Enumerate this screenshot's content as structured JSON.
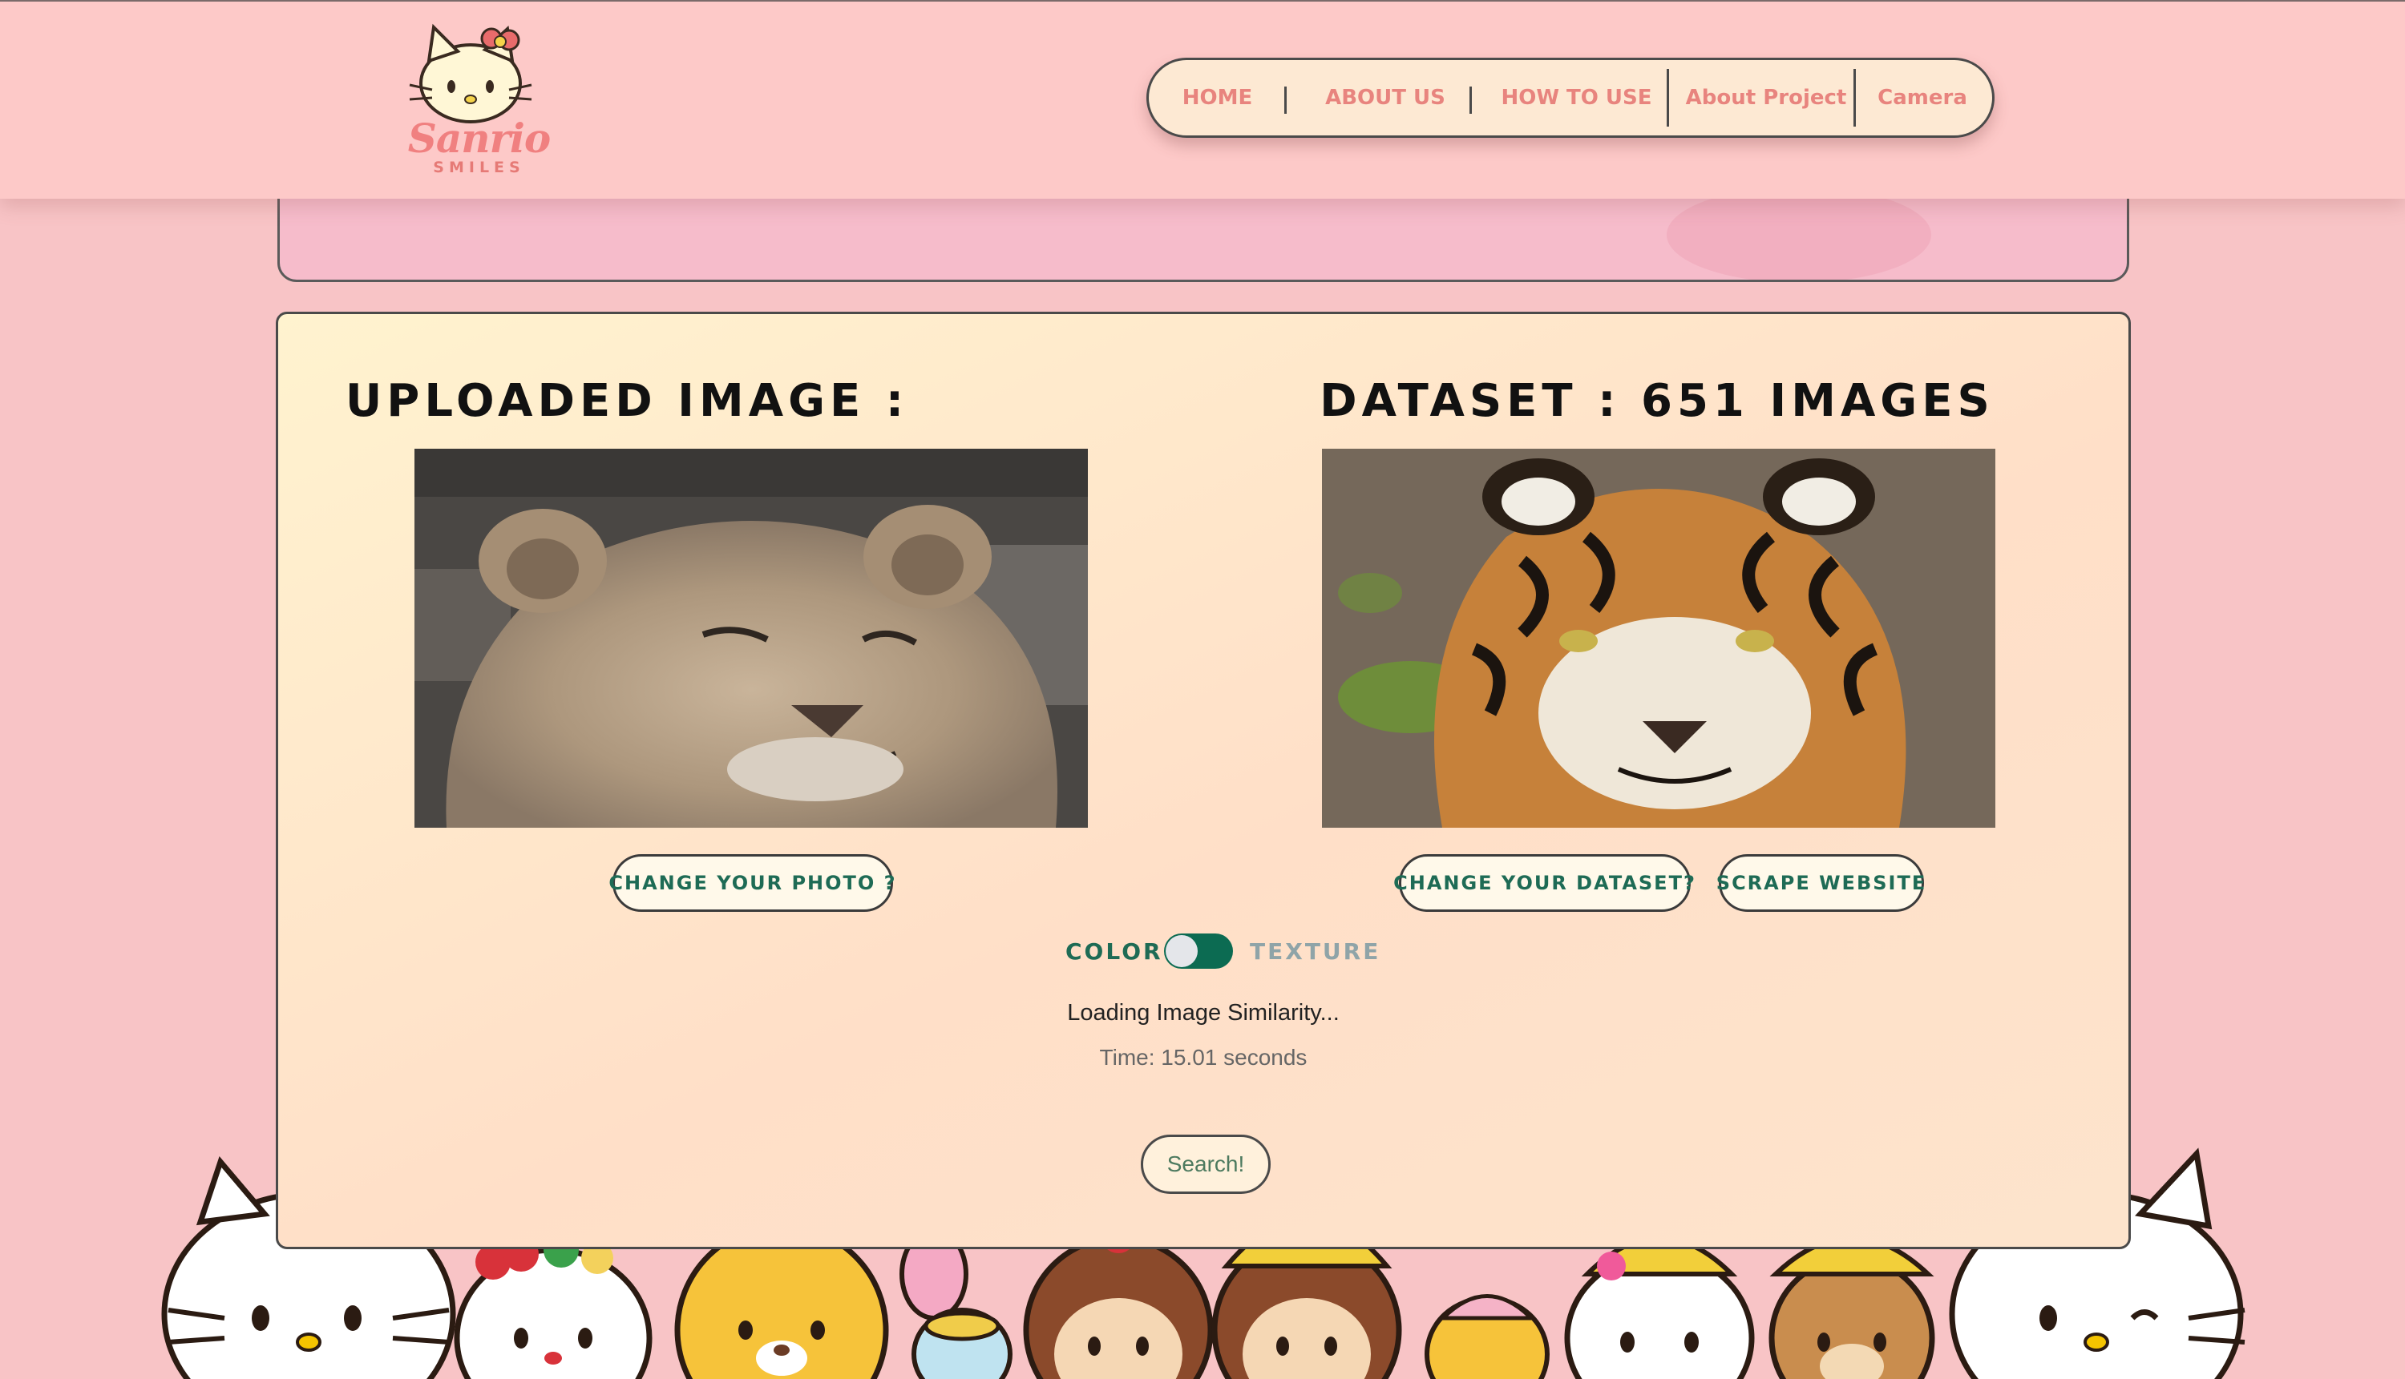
{
  "brand": {
    "logo_text": "Sanrio",
    "logo_subtitle": "SMILES"
  },
  "nav": {
    "items": [
      {
        "label": "HOME"
      },
      {
        "label": "ABOUT US"
      },
      {
        "label": "HOW TO USE"
      },
      {
        "label": "About Project"
      },
      {
        "label": "Camera"
      }
    ]
  },
  "main": {
    "uploaded_title": "UPLOADED IMAGE :",
    "dataset_title": "DATASET : 651 IMAGES",
    "uploaded_image_alt": "lion cub",
    "dataset_image_alt": "tiger",
    "change_photo_label": "CHANGE YOUR PHOTO ?",
    "change_dataset_label": "CHANGE YOUR DATASET?",
    "scrape_label": "SCRAPE WEBSITE",
    "toggle": {
      "left_label": "COLOR",
      "right_label": "TEXTURE",
      "state": "texture"
    },
    "status": "Loading Image Similarity...",
    "time": "Time: 15.01 seconds",
    "search_label": "Search!"
  },
  "colors": {
    "background": "#f8c4c6",
    "navbar": "#fdc9c8",
    "nav_text": "#e8847e",
    "button_text": "#1e6b55",
    "toggle_on": "#0c6b52",
    "texture_label": "#8fa4a8",
    "search_text": "#4d7a5f"
  }
}
